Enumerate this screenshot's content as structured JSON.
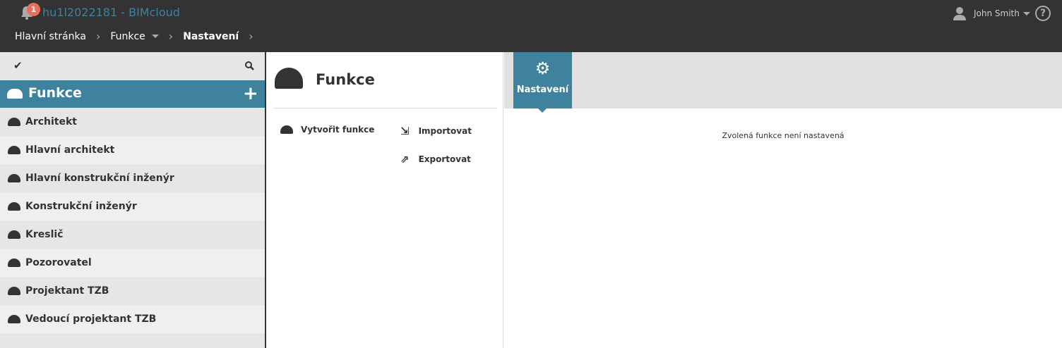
{
  "header": {
    "notification_count": "1",
    "app_title": "hu1l2022181 - BIMcloud",
    "user_name": "John Smith",
    "help": "?",
    "breadcrumb": [
      "Hlavní stránka",
      "Funkce",
      "Nastavení"
    ]
  },
  "sidebar": {
    "title": "Funkce",
    "items": [
      "Architekt",
      "Hlavní architekt",
      "Hlavní konstrukční inženýr",
      "Konstrukční inženýr",
      "Kreslič",
      "Pozorovatel",
      "Projektant TZB",
      "Vedoucí projektant TZB"
    ]
  },
  "middle": {
    "title": "Funkce",
    "actions": {
      "create": "Vytvořit funkce",
      "import": "Importovat",
      "export": "Exportovat"
    }
  },
  "right": {
    "tab": "Nastavení",
    "message": "Zvolená funkce není nastavená"
  },
  "colors": {
    "accent": "#3f829d",
    "header": "#333333",
    "badge": "#e9705c"
  }
}
